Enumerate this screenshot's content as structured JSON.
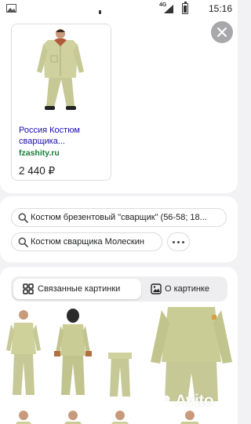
{
  "status_bar": {
    "network": "4G",
    "time": "15:16"
  },
  "product": {
    "source": "Россия Костюм сварщика...",
    "domain": "fzashity.ru",
    "price": "2 440 ₽"
  },
  "suggestions": [
    {
      "label": "Костюм брезентовый \"сварщик\" (56-58; 18..."
    },
    {
      "label": "Костюм сварщика Молескин"
    }
  ],
  "tabs": [
    {
      "label": "Связанные картинки",
      "icon": "grid-icon",
      "active": true
    },
    {
      "label": "О картинке",
      "icon": "image-icon",
      "active": false
    }
  ],
  "watermark": {
    "text": "Avito"
  },
  "colors": {
    "link": "#1a0dab",
    "domain": "#188038",
    "suit": "#c9cc9a",
    "panel_bg": "#f2f2f4"
  }
}
